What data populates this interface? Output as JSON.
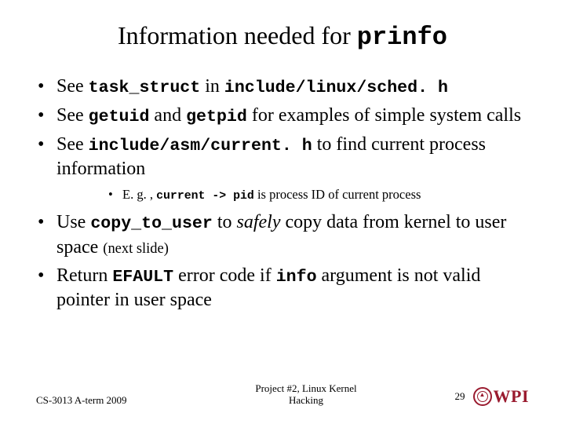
{
  "title": {
    "prefix": "Information needed for ",
    "code": "prinfo"
  },
  "bullets": {
    "b1": {
      "t0": "See ",
      "c1": "task_struct",
      "t1": " in ",
      "c2": "include/linux/sched. h"
    },
    "b2": {
      "t0": "See ",
      "c1": "getuid",
      "t1": " and ",
      "c2": "getpid",
      "t2": " for examples of simple system calls"
    },
    "b3": {
      "t0": "See ",
      "c1": "include/asm/current. h",
      "t1": " to find current process information"
    },
    "b3sub": {
      "t0": "E. g. , ",
      "c1": "current -> pid",
      "t1": " is process ID of current process"
    },
    "b4": {
      "t0": "Use ",
      "c1": "copy_to_user",
      "t1": " to ",
      "i1": "safely",
      "t2": " copy data from kernel to user space ",
      "p1": "(next slide)"
    },
    "b5": {
      "t0": "Return ",
      "c1": "EFAULT",
      "t1": " error code if ",
      "c2": "info",
      "t2": " argument is not valid pointer in user space"
    }
  },
  "footer": {
    "left": "CS-3013 A-term 2009",
    "center_line1": "Project #2, Linux Kernel",
    "center_line2": "Hacking",
    "page": "29",
    "logo_text": "WPI"
  }
}
